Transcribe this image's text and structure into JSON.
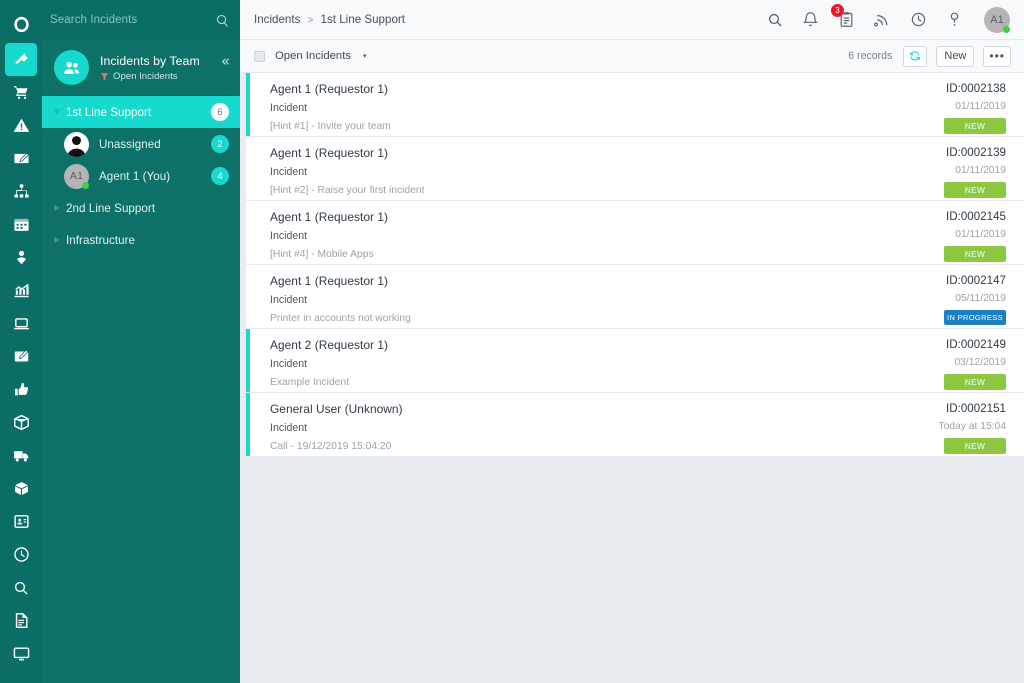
{
  "colors": {
    "rail_bg": "#0a6e66",
    "sidebar_panel": "#0d7168",
    "accent_teal": "#17d9cd",
    "list_bg": "#e9edf2",
    "status_new": "#8dc63f",
    "status_inprogress": "#1c7fc4",
    "badge_red": "#e8192c",
    "presence_green": "#3fd14a",
    "funnel_red": "#e8796f"
  },
  "rail": {
    "items": [
      {
        "icon": "logo-circle-icon",
        "active": false
      },
      {
        "icon": "lightning-bolt-icon",
        "active": true
      },
      {
        "icon": "shopping-cart-icon",
        "active": false
      },
      {
        "icon": "warning-triangle-icon",
        "active": false
      },
      {
        "icon": "pencil-edit-icon",
        "active": false
      },
      {
        "icon": "org-chart-icon",
        "active": false
      },
      {
        "icon": "calendar-icon",
        "active": false
      },
      {
        "icon": "user-location-icon",
        "active": false
      },
      {
        "icon": "bar-chart-icon",
        "active": false
      },
      {
        "icon": "laptop-icon",
        "active": false
      },
      {
        "icon": "note-pencil-icon",
        "active": false
      },
      {
        "icon": "thumbs-up-icon",
        "active": false
      },
      {
        "icon": "package-box-icon",
        "active": false
      },
      {
        "icon": "delivery-truck-icon",
        "active": false
      },
      {
        "icon": "open-box-icon",
        "active": false
      },
      {
        "icon": "id-card-icon",
        "active": false
      },
      {
        "icon": "clock-icon",
        "active": false
      },
      {
        "icon": "search-icon",
        "active": false
      },
      {
        "icon": "document-icon",
        "active": false
      },
      {
        "icon": "monitor-icon",
        "active": false
      }
    ]
  },
  "search": {
    "placeholder": "Search Incidents",
    "value": "",
    "icon": "search-icon"
  },
  "sidebar": {
    "panel_title": "Incidents by Team",
    "panel_filter": "Open Incidents",
    "filter_icon": "funnel-filter-icon",
    "avatar_icon": "team-group-icon",
    "collapse_label": "«",
    "tree": [
      {
        "label": "1st Line Support",
        "count": "6",
        "selected": true,
        "expanded": true,
        "type": "group",
        "children": [
          {
            "label": "Unassigned",
            "count": "2",
            "avatar_type": "silhouette",
            "initials": "",
            "online": false
          },
          {
            "label": "Agent 1 (You)",
            "count": "4",
            "avatar_type": "initials",
            "initials": "A1",
            "online": true
          }
        ]
      },
      {
        "label": "2nd Line Support",
        "count": "",
        "selected": false,
        "expanded": false,
        "type": "group",
        "children": []
      },
      {
        "label": "Infrastructure",
        "count": "",
        "selected": false,
        "expanded": false,
        "type": "group",
        "children": []
      }
    ]
  },
  "header": {
    "breadcrumb": [
      "Incidents",
      "1st Line Support"
    ],
    "separator": ">",
    "icons": [
      {
        "name": "search-icon",
        "badge": ""
      },
      {
        "name": "bell-notification-icon",
        "badge": ""
      },
      {
        "name": "clipboard-tasks-icon",
        "badge": "3"
      },
      {
        "name": "rss-feed-icon",
        "badge": ""
      },
      {
        "name": "clock-history-icon",
        "badge": ""
      },
      {
        "name": "help-question-icon",
        "badge": ""
      }
    ],
    "user_initials": "A1",
    "user_online": true
  },
  "toolbar": {
    "select_all_checkbox": false,
    "view_name": "Open Incidents",
    "dropdown_caret": "▾",
    "records_label": "6 records",
    "refresh_label": "⟳",
    "new_label": "New",
    "more_label": "•••"
  },
  "incidents": [
    {
      "title": "Agent 1 (Requestor 1)",
      "type": "Incident",
      "description": "[Hint #1] - Invite your team",
      "id": "ID:0002138",
      "date": "01/11/2019",
      "status": "NEW",
      "status_kind": "new",
      "accent": true
    },
    {
      "title": "Agent 1 (Requestor 1)",
      "type": "Incident",
      "description": "[Hint #2] - Raise your first incident",
      "id": "ID:0002139",
      "date": "01/11/2019",
      "status": "NEW",
      "status_kind": "new",
      "accent": false
    },
    {
      "title": "Agent 1 (Requestor 1)",
      "type": "Incident",
      "description": "[Hint #4] - Mobile Apps",
      "id": "ID:0002145",
      "date": "01/11/2019",
      "status": "NEW",
      "status_kind": "new",
      "accent": false
    },
    {
      "title": "Agent 1 (Requestor 1)",
      "type": "Incident",
      "description": "Printer in accounts not working",
      "id": "ID:0002147",
      "date": "05/11/2019",
      "status": "IN PROGRESS",
      "status_kind": "inprogress",
      "accent": false
    },
    {
      "title": "Agent 2 (Requestor 1)",
      "type": "Incident",
      "description": "Example Incident",
      "id": "ID:0002149",
      "date": "03/12/2019",
      "status": "NEW",
      "status_kind": "new",
      "accent": true
    },
    {
      "title": "General User (Unknown)",
      "type": "Incident",
      "description": "Call - 19/12/2019 15:04:20",
      "id": "ID:0002151",
      "date": "Today at 15:04",
      "status": "NEW",
      "status_kind": "new",
      "accent": true
    }
  ]
}
